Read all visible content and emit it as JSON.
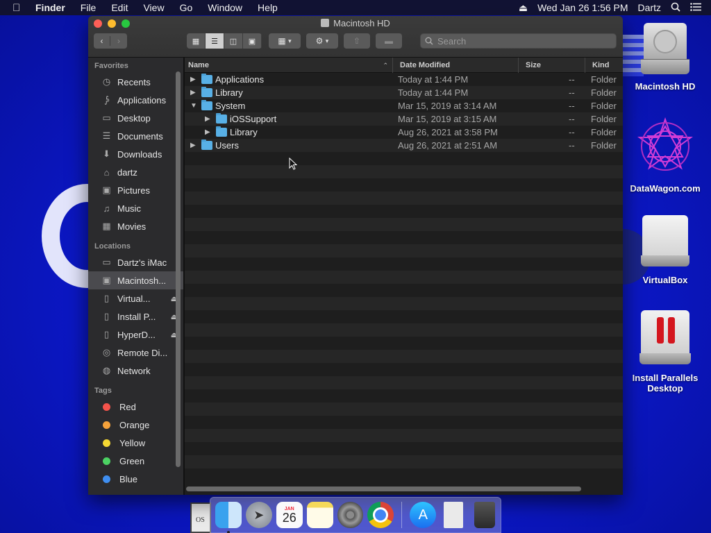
{
  "menubar": {
    "app": "Finder",
    "menus": [
      "File",
      "Edit",
      "View",
      "Go",
      "Window",
      "Help"
    ],
    "datetime": "Wed Jan 26  1:56 PM",
    "user": "Dartz"
  },
  "desktop": {
    "icons": [
      {
        "label": "Macintosh HD"
      },
      {
        "label": "DataWagon.com"
      },
      {
        "label": "VirtualBox"
      },
      {
        "label": "Install Parallels Desktop"
      }
    ],
    "os_label": "OS"
  },
  "window": {
    "title": "Macintosh HD",
    "search_placeholder": "Search"
  },
  "sidebar": {
    "favorites_header": "Favorites",
    "favorites": [
      {
        "label": "Recents",
        "icon": "clock-icon"
      },
      {
        "label": "Applications",
        "icon": "applications-icon"
      },
      {
        "label": "Desktop",
        "icon": "desktop-icon"
      },
      {
        "label": "Documents",
        "icon": "document-icon"
      },
      {
        "label": "Downloads",
        "icon": "download-icon"
      },
      {
        "label": "dartz",
        "icon": "home-icon"
      },
      {
        "label": "Pictures",
        "icon": "camera-icon"
      },
      {
        "label": "Music",
        "icon": "music-note-icon"
      },
      {
        "label": "Movies",
        "icon": "film-icon"
      }
    ],
    "locations_header": "Locations",
    "locations": [
      {
        "label": "Dartz's iMac",
        "icon": "imac-icon"
      },
      {
        "label": "Macintosh...",
        "icon": "hard-drive-icon"
      },
      {
        "label": "Virtual...",
        "icon": "disk-icon",
        "eject": true
      },
      {
        "label": "Install P...",
        "icon": "disk-icon",
        "eject": true
      },
      {
        "label": "HyperD...",
        "icon": "disk-icon",
        "eject": true
      },
      {
        "label": "Remote Di...",
        "icon": "optical-disc-icon"
      },
      {
        "label": "Network",
        "icon": "globe-icon"
      }
    ],
    "tags_header": "Tags",
    "tags": [
      {
        "label": "Red",
        "color": "#f4534b"
      },
      {
        "label": "Orange",
        "color": "#f5a23b"
      },
      {
        "label": "Yellow",
        "color": "#f5d833"
      },
      {
        "label": "Green",
        "color": "#4cd263"
      },
      {
        "label": "Blue",
        "color": "#3f8ef0"
      }
    ]
  },
  "columns": {
    "name": "Name",
    "date": "Date Modified",
    "size": "Size",
    "kind": "Kind"
  },
  "rows": [
    {
      "name": "Applications",
      "date": "Today at 1:44 PM",
      "size": "--",
      "kind": "Folder",
      "level": 0,
      "expanded": false
    },
    {
      "name": "Library",
      "date": "Today at 1:44 PM",
      "size": "--",
      "kind": "Folder",
      "level": 0,
      "expanded": false
    },
    {
      "name": "System",
      "date": "Mar 15, 2019 at 3:14 AM",
      "size": "--",
      "kind": "Folder",
      "level": 0,
      "expanded": true
    },
    {
      "name": "iOSSupport",
      "date": "Mar 15, 2019 at 3:15 AM",
      "size": "--",
      "kind": "Folder",
      "level": 1,
      "expanded": false
    },
    {
      "name": "Library",
      "date": "Aug 26, 2021 at 3:58 PM",
      "size": "--",
      "kind": "Folder",
      "level": 1,
      "expanded": false
    },
    {
      "name": "Users",
      "date": "Aug 26, 2021 at 2:51 AM",
      "size": "--",
      "kind": "Folder",
      "level": 0,
      "expanded": false
    }
  ],
  "dock": {
    "calendar_month": "JAN",
    "calendar_day": "26"
  }
}
